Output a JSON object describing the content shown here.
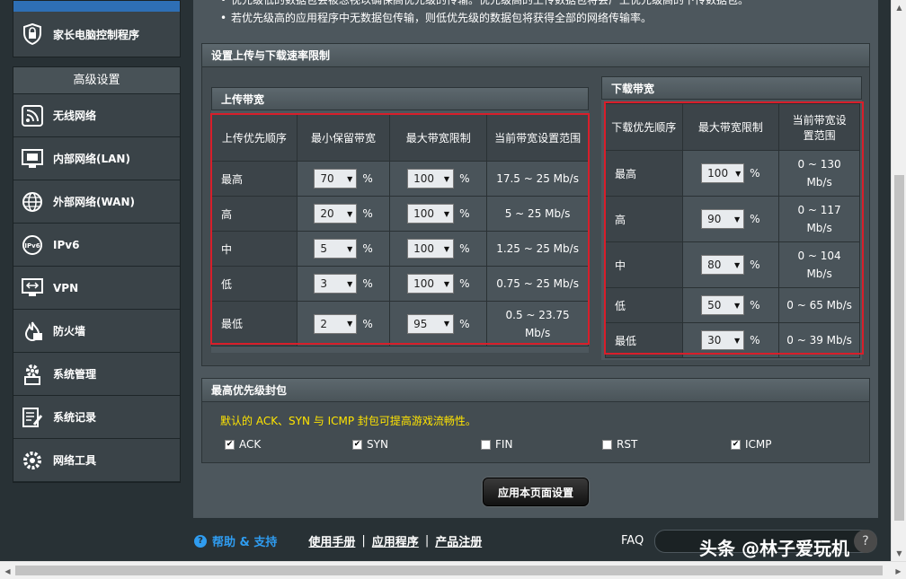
{
  "sidebar": {
    "top_item": {
      "label": "家长电脑控制程序",
      "icon": "lock-icon"
    },
    "advanced_title": "高级设置",
    "items": [
      {
        "label": "无线网络",
        "icon": "wifi-icon"
      },
      {
        "label": "内部网络(LAN)",
        "icon": "lan-icon"
      },
      {
        "label": "外部网络(WAN)",
        "icon": "globe-icon"
      },
      {
        "label": "IPv6",
        "icon": "ipv6-icon"
      },
      {
        "label": "VPN",
        "icon": "vpn-icon"
      },
      {
        "label": "防火墙",
        "icon": "firewall-icon"
      },
      {
        "label": "系统管理",
        "icon": "gear-icon"
      },
      {
        "label": "系统记录",
        "icon": "log-icon"
      },
      {
        "label": "网络工具",
        "icon": "tools-icon"
      }
    ]
  },
  "bullets": [
    "优先级低的数据包会被忽视以确保高优先级的传输。优先级高的上传数据包将会广上优先级高的下传数据包。",
    "若优先级高的应用程序中无数据包传输，则低优先级的数据包将获得全部的网络传输率。"
  ],
  "rate_section": {
    "title": "设置上传与下载速率限制",
    "upload": {
      "title": "上传带宽",
      "headers": [
        "上传优先顺序",
        "最小保留带宽",
        "最大带宽限制",
        "当前带宽设置范围"
      ],
      "rows": [
        {
          "priority": "最高",
          "min": "70",
          "max": "100",
          "range": "17.5 ~ 25 Mb/s"
        },
        {
          "priority": "高",
          "min": "20",
          "max": "100",
          "range": "5 ~ 25 Mb/s"
        },
        {
          "priority": "中",
          "min": "5",
          "max": "100",
          "range": "1.25 ~ 25 Mb/s"
        },
        {
          "priority": "低",
          "min": "3",
          "max": "100",
          "range": "0.75 ~ 25 Mb/s"
        },
        {
          "priority": "最低",
          "min": "2",
          "max": "95",
          "range": "0.5 ~ 23.75 Mb/s"
        }
      ]
    },
    "download": {
      "title": "下载带宽",
      "headers": [
        "下载优先顺序",
        "最大带宽限制",
        "当前带宽设置范围"
      ],
      "rows": [
        {
          "priority": "最高",
          "max": "100",
          "range": "0 ~ 130 Mb/s"
        },
        {
          "priority": "高",
          "max": "90",
          "range": "0 ~ 117 Mb/s"
        },
        {
          "priority": "中",
          "max": "80",
          "range": "0 ~ 104 Mb/s"
        },
        {
          "priority": "低",
          "max": "50",
          "range": "0 ~ 65 Mb/s"
        },
        {
          "priority": "最低",
          "max": "30",
          "range": "0 ~ 39 Mb/s"
        }
      ]
    },
    "percent": "%"
  },
  "packet_section": {
    "title": "最高优先级封包",
    "note": "默认的 ACK、SYN 与 ICMP 封包可提高游戏流畅性。",
    "options": [
      {
        "label": "ACK",
        "checked": "✔"
      },
      {
        "label": "SYN",
        "checked": "✔"
      },
      {
        "label": "FIN",
        "checked": ""
      },
      {
        "label": "RST",
        "checked": ""
      },
      {
        "label": "ICMP",
        "checked": "✔"
      }
    ]
  },
  "apply_label": "应用本页面设置",
  "footer": {
    "help": "帮助 & 支持",
    "links": [
      "使用手册",
      "应用程序",
      "产品注册"
    ],
    "faq": "FAQ",
    "watermark": "头条 @林子爱玩机"
  },
  "colors": {
    "highlight": "#d81e2a",
    "note": "#ffe400",
    "help_link": "#2f9cf0"
  }
}
